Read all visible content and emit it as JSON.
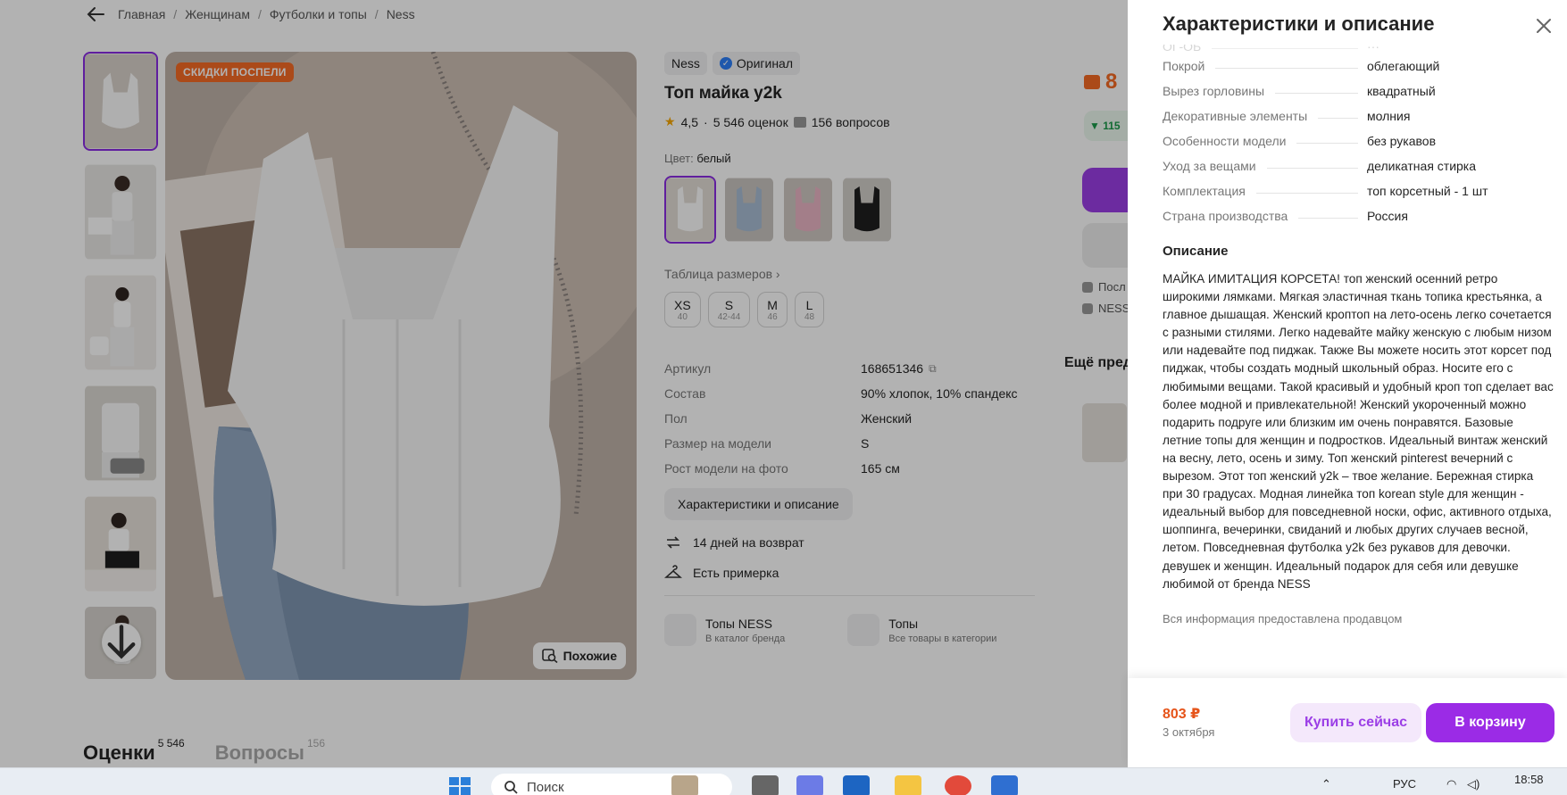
{
  "breadcrumb": [
    "Главная",
    "Женщинам",
    "Футболки и топы",
    "Ness"
  ],
  "product": {
    "sale_badge": "СКИДКИ ПОСПЕЛИ",
    "similar_label": "Похожие",
    "brand": "Ness",
    "original_label": "Оригинал",
    "title": "Топ майка y2k",
    "rating": "4,5",
    "reviews": "5 546 оценок",
    "questions": "156 вопросов",
    "color_label": "Цвет:",
    "color_value": "белый",
    "size_table_label": "Таблица размеров",
    "sizes": [
      {
        "label": "XS",
        "sub": "40"
      },
      {
        "label": "S",
        "sub": "42-44"
      },
      {
        "label": "M",
        "sub": "46"
      },
      {
        "label": "L",
        "sub": "48"
      }
    ],
    "specs": [
      {
        "k": "Артикул",
        "v": "168651346"
      },
      {
        "k": "Состав",
        "v": "90% хлопок, 10% спандекс"
      },
      {
        "k": "Пол",
        "v": "Женский"
      },
      {
        "k": "Размер на модели",
        "v": "S"
      },
      {
        "k": "Рост модели на фото",
        "v": "165 см"
      }
    ],
    "char_button": "Характеристики и описание",
    "perks": [
      "14 дней на возврат",
      "Есть примерка"
    ],
    "categories": [
      {
        "title": "Топы NESS",
        "sub": "В каталог бренда"
      },
      {
        "title": "Топы",
        "sub": "Все товары в категории"
      }
    ]
  },
  "buy_card": {
    "price_fragment": "8",
    "green_fragment": "▼ 115",
    "seller_frag_1": "Посл",
    "seller_frag_2": "NESS"
  },
  "more_title": "Ещё пред",
  "bottom_tabs": [
    {
      "label": "Оценки",
      "count": "5 546"
    },
    {
      "label": "Вопросы",
      "count": "156"
    }
  ],
  "panel": {
    "title": "Характеристики и описание",
    "rows": [
      {
        "k": "Покрой",
        "v": "облегающий"
      },
      {
        "k": "Вырез горловины",
        "v": "квадратный"
      },
      {
        "k": "Декоративные элементы",
        "v": "молния"
      },
      {
        "k": "Особенности модели",
        "v": "без рукавов"
      },
      {
        "k": "Уход за вещами",
        "v": "деликатная стирка"
      },
      {
        "k": "Комплектация",
        "v": "топ корсетный - 1 шт"
      },
      {
        "k": "Страна производства",
        "v": "Россия"
      }
    ],
    "description_title": "Описание",
    "description": "МАЙКА ИМИТАЦИЯ КОРСЕТА! топ женский осенний ретро широкими лямками. Мягкая эластичная ткань топика крестьянка, а главное дышащая. Женский кроптоп на лето-осень легко сочетается с разными стилями. Легко надевайте майку женскую с любым низом или надевайте под пиджак. Также Вы можете носить этот корсет под пиджак, чтобы создать модный школьный образ. Носите его с любимыми вещами. Такой красивый и удобный кроп топ сделает вас более модной и привлекательной! Женский укороченный можно подарить подруге или близким им очень понравятся. Базовые летние топы для женщин и подростков. Идеальный винтаж женский на весну, лето, осень и зиму. Топ женский pinterest вечерний с вырезом. Этот топ женский y2k – твое желание. Бережная стирка при 30 градусах. Модная линейка топ korean style для женщин - идеальный выбор для повседневной носки, офис, активного отдыха, шоппинга, вечеринки, свиданий и любых других случаев весной, летом. Повседневная футболка y2k без рукавов для девочки. девушек и женщин. Идеальный подарок для себя или девушке любимой от бренда NESS",
    "seller_note": "Вся информация предоставлена продавцом",
    "footer_price": "803 ₽",
    "footer_date": "3 октября",
    "buy_now": "Купить сейчас",
    "add_to_cart": "В корзину"
  },
  "taskbar": {
    "search_placeholder": "Поиск",
    "language": "РУС",
    "time": "18:58"
  },
  "colors": {
    "accent": "#9b2be6",
    "price": "#e6541a",
    "sale_badge": "#f56a24"
  }
}
